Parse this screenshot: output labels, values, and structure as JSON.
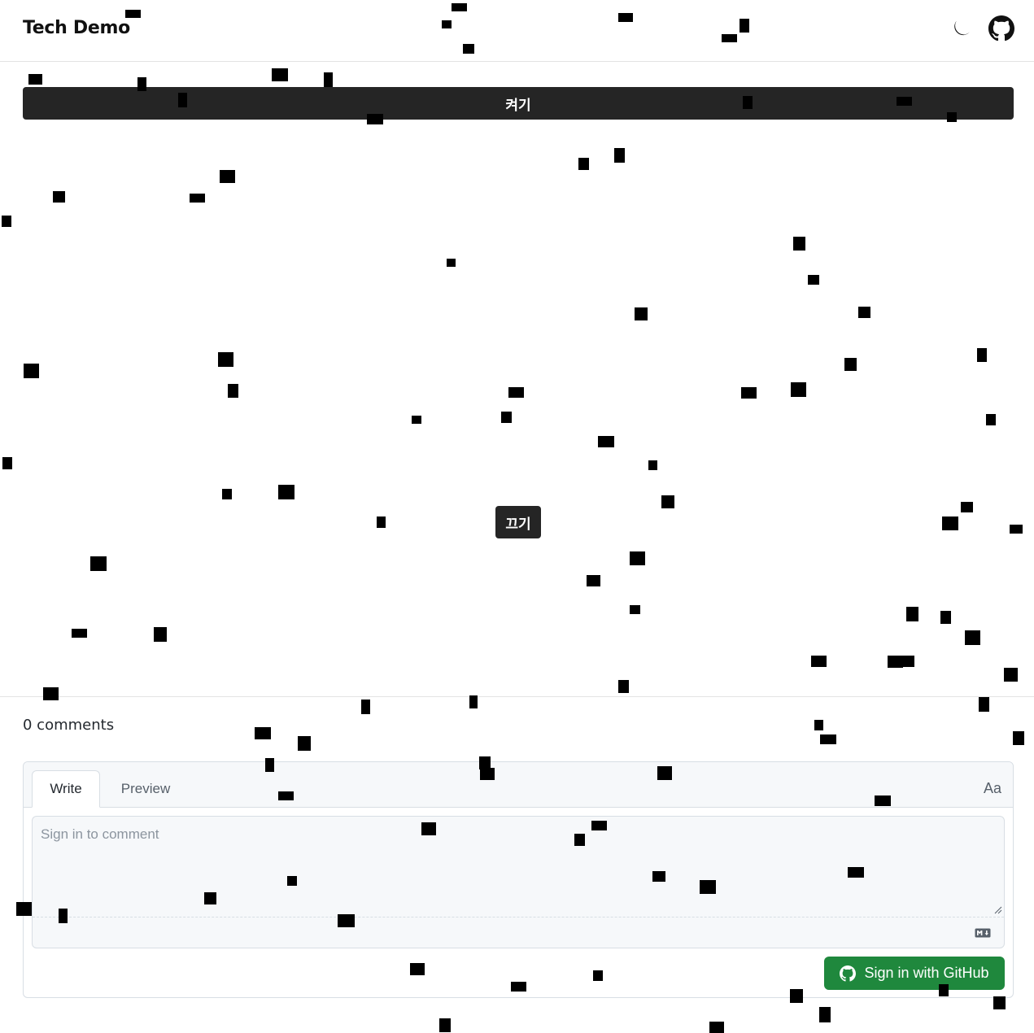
{
  "header": {
    "site_title": "Tech Demo",
    "theme_toggle_icon": "moon-icon",
    "repo_icon": "github-icon"
  },
  "main": {
    "on_button_label": "켜기",
    "off_button_label": "끄기"
  },
  "comments": {
    "count_label": "0 comments",
    "tabs": [
      {
        "label": "Write",
        "active": true
      },
      {
        "label": "Preview",
        "active": false
      }
    ],
    "format_label": "Aa",
    "input_placeholder": "Sign in to comment",
    "input_value": "",
    "markdown_icon": "markdown-icon",
    "signin_label": "Sign in with GitHub",
    "signin_color": "#1f883d"
  },
  "colors": {
    "button_bg": "#252525",
    "particle": "#000000"
  }
}
